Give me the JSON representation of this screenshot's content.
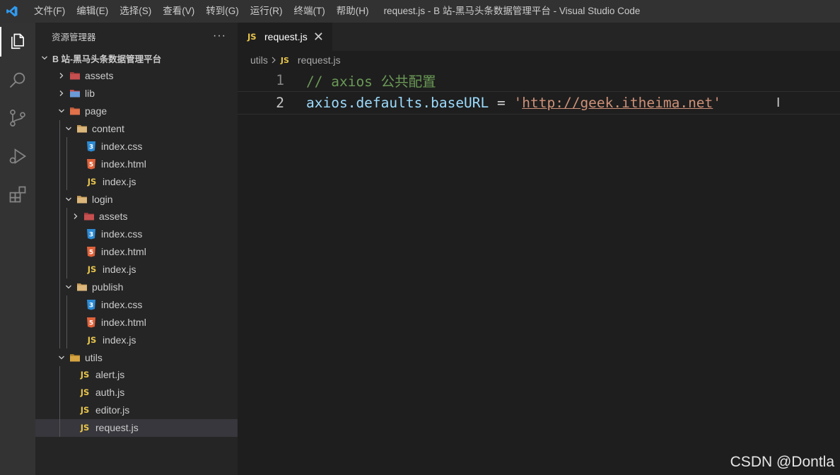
{
  "titlebar": {
    "menu": [
      "文件(F)",
      "编辑(E)",
      "选择(S)",
      "查看(V)",
      "转到(G)",
      "运行(R)",
      "终端(T)",
      "帮助(H)"
    ],
    "title": "request.js - B 站-黑马头条数据管理平台 - Visual Studio Code"
  },
  "sidebar": {
    "header": "资源管理器",
    "more": "···",
    "root": "B 站-黑马头条数据管理平台",
    "tree": [
      {
        "label": "assets",
        "indent": 1,
        "type": "folder-assets",
        "chev": "right"
      },
      {
        "label": "lib",
        "indent": 1,
        "type": "folder-lib",
        "chev": "right"
      },
      {
        "label": "page",
        "indent": 1,
        "type": "folder-page",
        "chev": "down"
      },
      {
        "label": "content",
        "indent": 2,
        "type": "folder",
        "chev": "down"
      },
      {
        "label": "index.css",
        "indent": 3,
        "type": "css"
      },
      {
        "label": "index.html",
        "indent": 3,
        "type": "html"
      },
      {
        "label": "index.js",
        "indent": 3,
        "type": "js"
      },
      {
        "label": "login",
        "indent": 2,
        "type": "folder",
        "chev": "down"
      },
      {
        "label": "assets",
        "indent": 3,
        "type": "folder-assets",
        "chev": "right"
      },
      {
        "label": "index.css",
        "indent": 3,
        "type": "css"
      },
      {
        "label": "index.html",
        "indent": 3,
        "type": "html"
      },
      {
        "label": "index.js",
        "indent": 3,
        "type": "js"
      },
      {
        "label": "publish",
        "indent": 2,
        "type": "folder",
        "chev": "down"
      },
      {
        "label": "index.css",
        "indent": 3,
        "type": "css"
      },
      {
        "label": "index.html",
        "indent": 3,
        "type": "html"
      },
      {
        "label": "index.js",
        "indent": 3,
        "type": "js"
      },
      {
        "label": "utils",
        "indent": 1,
        "type": "folder-utils",
        "chev": "down"
      },
      {
        "label": "alert.js",
        "indent": 2,
        "type": "js"
      },
      {
        "label": "auth.js",
        "indent": 2,
        "type": "js"
      },
      {
        "label": "editor.js",
        "indent": 2,
        "type": "js"
      },
      {
        "label": "request.js",
        "indent": 2,
        "type": "js",
        "selected": true
      }
    ]
  },
  "editor": {
    "tab_label": "request.js",
    "tab_close": "✕",
    "breadcrumb": [
      "utils",
      "request.js"
    ],
    "js_badge": "JS",
    "lines": [
      {
        "num": "1",
        "comment": "// axios 公共配置"
      },
      {
        "num": "2",
        "code": "axios.defaults.baseURL",
        "op": " = ",
        "quote": "'",
        "url": "http://geek.itheima.net"
      }
    ]
  },
  "watermark": "CSDN @Dontla"
}
